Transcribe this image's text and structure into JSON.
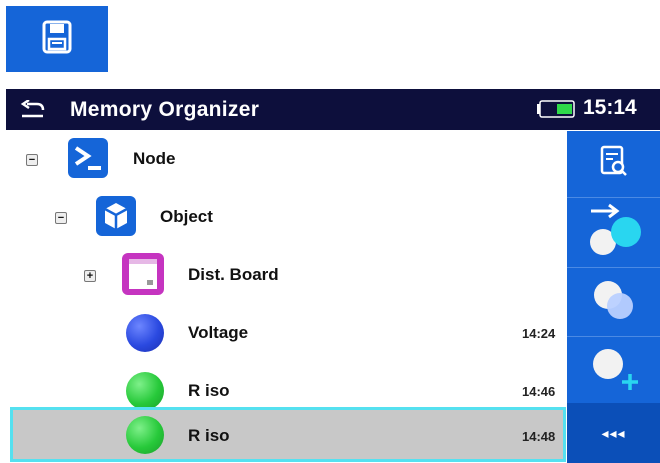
{
  "header": {
    "title": "Memory Organizer",
    "time": "15:14"
  },
  "tree": {
    "rows": [
      {
        "label": "Node",
        "icon": "node-terminal-icon",
        "expander": "−"
      },
      {
        "label": "Object",
        "icon": "object-cube-icon",
        "expander": "−"
      },
      {
        "label": "Dist. Board",
        "icon": "distribution-board-icon",
        "expander": "+"
      },
      {
        "label": "Voltage",
        "icon": "measurement-ball-blue-icon",
        "time": "14:24"
      },
      {
        "label": "R iso",
        "icon": "measurement-ball-green-icon",
        "time": "14:46"
      },
      {
        "label": "R iso",
        "icon": "measurement-ball-green-icon",
        "time": "14:48",
        "selected": true
      }
    ]
  },
  "toolbar": {
    "more_label": "◂◂◂"
  },
  "colors": {
    "header_bg": "#0d0f3c",
    "accent_blue": "#1565d8",
    "selection_bg": "#c8c8c8",
    "selection_border": "#55e1f0",
    "ball_blue": "#2a49e0",
    "ball_green": "#27c93a"
  }
}
